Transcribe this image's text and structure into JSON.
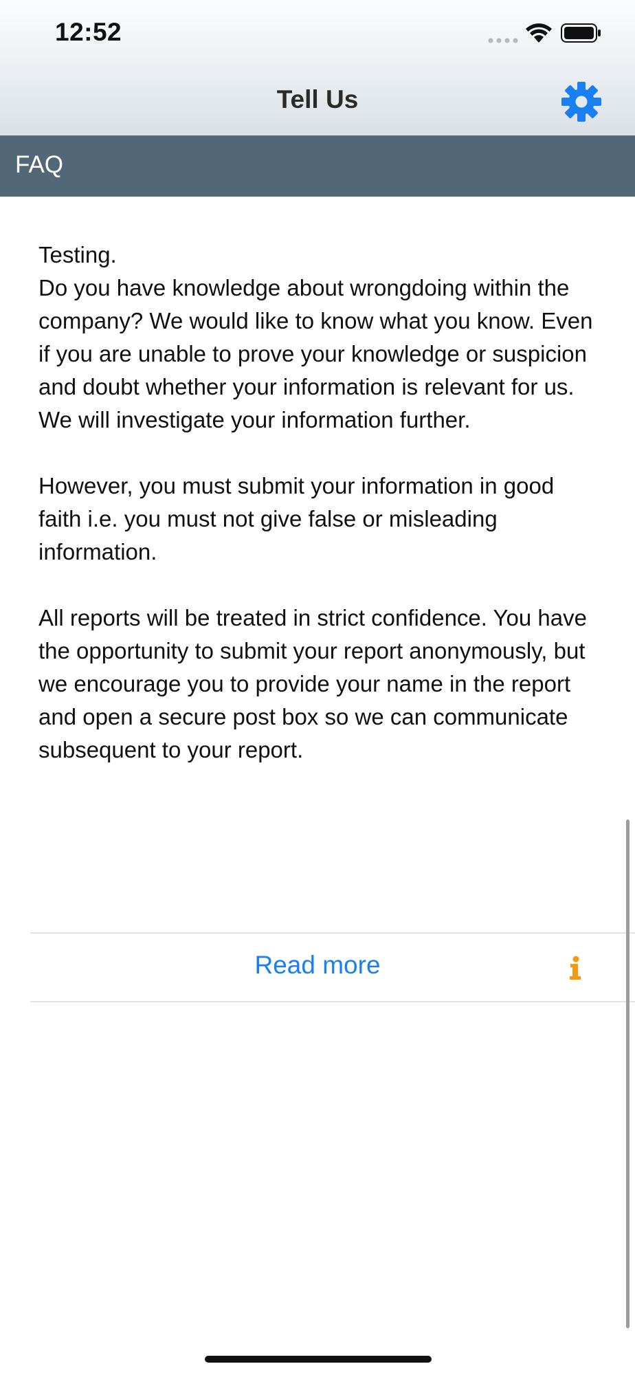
{
  "status_bar": {
    "time": "12:52"
  },
  "nav": {
    "title": "Tell Us",
    "settings_icon": "gear-icon",
    "settings_color": "#1a7ff0"
  },
  "section": {
    "title": "FAQ",
    "background_color": "#526876"
  },
  "content": {
    "paragraphs": [
      "Testing.\nDo you have knowledge about wrongdoing within the company? We would like to know what you know. Even if you are unable to prove your knowledge or suspicion and doubt whether your information is relevant for us. We will investigate your information further.",
      "However, you must submit your information in good faith i.e. you must not give false or misleading information.",
      "All reports will be treated in strict confidence. You have the opportunity to submit your report anonymously, but we encourage you to provide your name in the report and open a secure post box so we can communicate subsequent to your report."
    ]
  },
  "read_more": {
    "label": "Read more",
    "link_color": "#1a7ff0",
    "info_icon": "info-icon",
    "info_color": "#f29a12"
  }
}
